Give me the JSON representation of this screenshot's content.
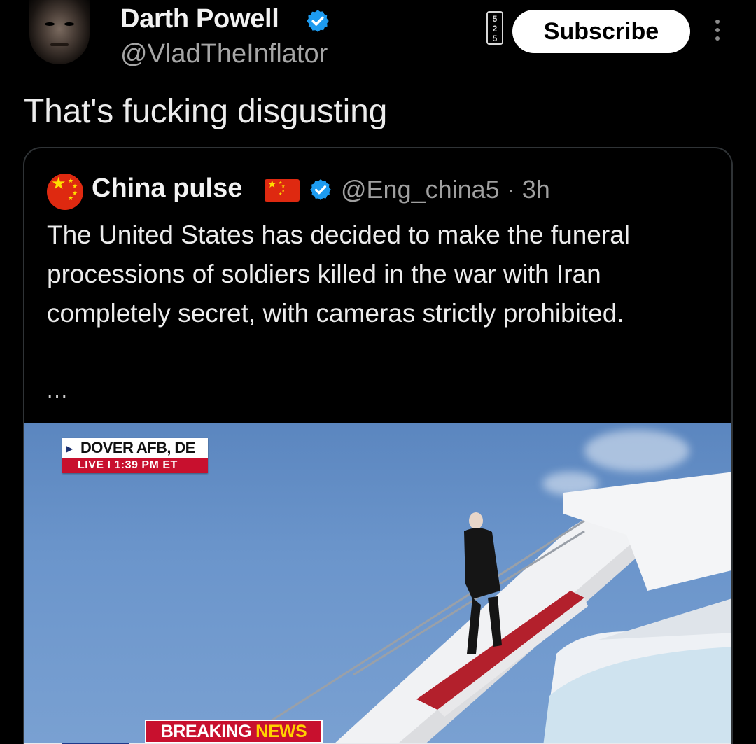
{
  "post": {
    "author_name": "Darth Powell",
    "author_handle": "@VladTheInflator",
    "verified": true,
    "subscribe_label": "Subscribe",
    "text": "That's fucking disgusting"
  },
  "quoted": {
    "author_name": "China pulse",
    "handle_and_time": "@Eng_china5 · 3h",
    "verified": true,
    "text": "The United States has decided to make the funeral processions of soldiers killed in the war with Iran completely secret, with cameras strictly prohibited.",
    "ellipsis": "..."
  },
  "media": {
    "location": "DOVER AFB, DE",
    "live": "LIVE  I  1:39 PM ET",
    "breaking": "BREAKING",
    "news": "NEWS"
  },
  "colors": {
    "verified_blue": "#1d9bf0",
    "banner_red": "#c8102e",
    "news_yellow": "#ffd200"
  },
  "icons": [
    "verified-badge-icon",
    "more-options-icon",
    "china-flag-icon",
    "brand-logo-icon"
  ]
}
